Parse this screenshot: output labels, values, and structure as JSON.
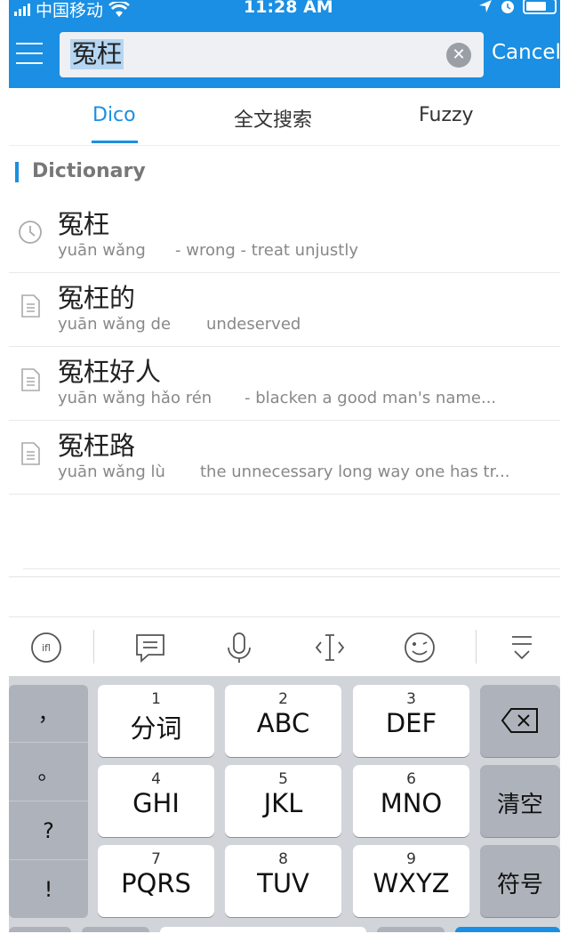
{
  "status_bar": {
    "carrier": "中国移动",
    "time": "11:28 AM"
  },
  "search": {
    "query": "冤枉",
    "cancel_label": "Cancel"
  },
  "tabs": [
    {
      "label": "Dico",
      "active": true
    },
    {
      "label": "全文搜索",
      "active": false
    },
    {
      "label": "Fuzzy",
      "active": false
    }
  ],
  "section": {
    "title": "Dictionary"
  },
  "results": [
    {
      "word": "冤枉",
      "pinyin": "yuān wǎng",
      "definition": "- wrong  - treat unjustly",
      "icon": "clock-icon"
    },
    {
      "word": "冤枉的",
      "pinyin": "yuān wǎng de",
      "definition": "undeserved",
      "icon": "document-icon"
    },
    {
      "word": "冤枉好人",
      "pinyin": "yuān wǎng hǎo rén",
      "definition": "- blacken a good man's name...",
      "icon": "document-icon"
    },
    {
      "word": "冤枉路",
      "pinyin": "yuān wǎng lù",
      "definition": "the unnecessary long way one has tr...",
      "icon": "document-icon"
    }
  ],
  "keyboard": {
    "punctuation": [
      "，",
      "。",
      "?",
      "!"
    ],
    "keys": [
      {
        "num": "1",
        "label": "分词"
      },
      {
        "num": "2",
        "label": "ABC"
      },
      {
        "num": "3",
        "label": "DEF"
      },
      {
        "num": "4",
        "label": "GHI"
      },
      {
        "num": "5",
        "label": "JKL"
      },
      {
        "num": "6",
        "label": "MNO"
      },
      {
        "num": "7",
        "label": "PQRS"
      },
      {
        "num": "8",
        "label": "TUV"
      },
      {
        "num": "9",
        "label": "WXYZ"
      }
    ],
    "clear_label": "清空",
    "symbols_label": "符号"
  },
  "colors": {
    "accent": "#1a8fe3",
    "keyboard_bg": "#d1d4d9",
    "function_key": "#aeb3bb"
  }
}
